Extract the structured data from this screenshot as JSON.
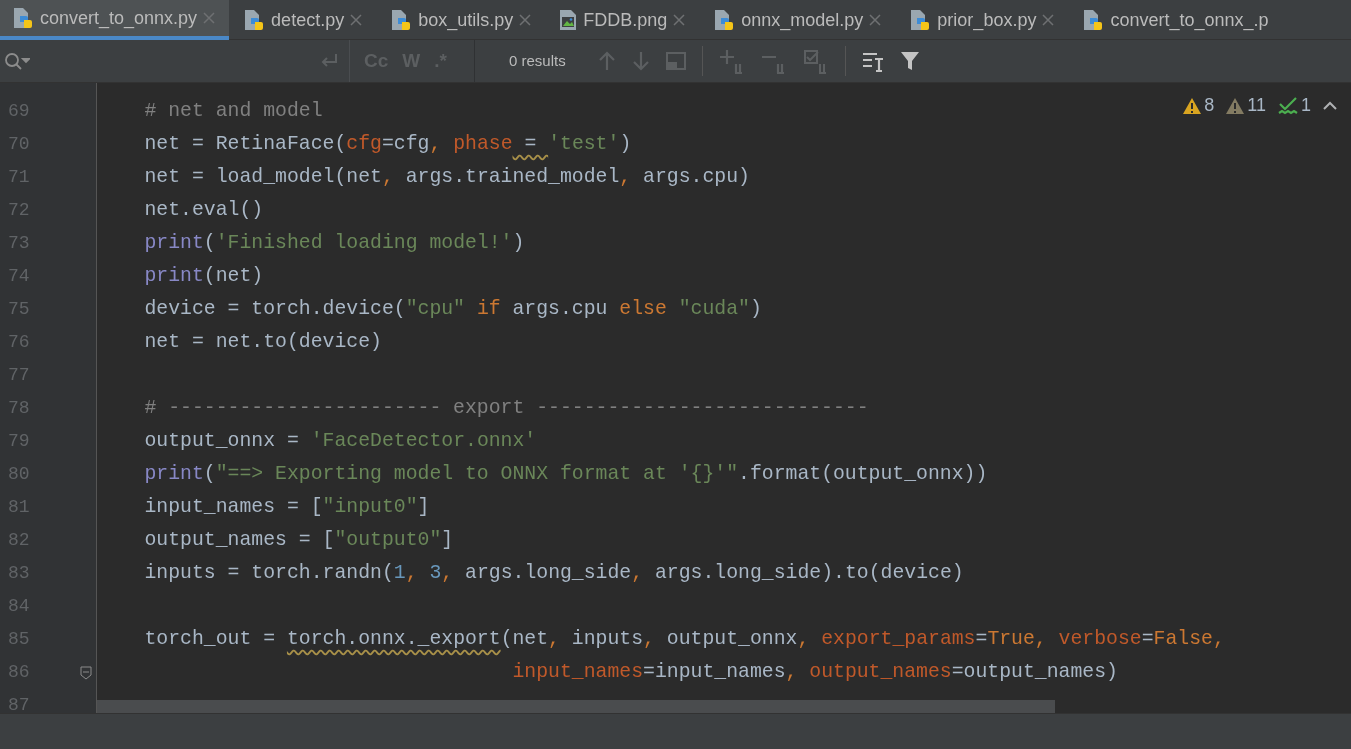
{
  "tabs": [
    {
      "label": "convert_to_onnx.py",
      "kind": "python",
      "selected": true
    },
    {
      "label": "detect.py",
      "kind": "python",
      "selected": false
    },
    {
      "label": "box_utils.py",
      "kind": "python",
      "selected": false
    },
    {
      "label": "FDDB.png",
      "kind": "image",
      "selected": false
    },
    {
      "label": "onnx_model.py",
      "kind": "python",
      "selected": false
    },
    {
      "label": "prior_box.py",
      "kind": "python",
      "selected": false
    },
    {
      "label": "convert_to_onnx_.p",
      "kind": "python",
      "selected": false
    }
  ],
  "find_bar": {
    "results": "0 results",
    "options": [
      "Cc",
      "W",
      ".*"
    ]
  },
  "inspections": [
    {
      "kind": "warning",
      "count": "8"
    },
    {
      "kind": "weak_warning",
      "count": "11"
    },
    {
      "kind": "typo",
      "count": "1"
    }
  ],
  "lines": [
    {
      "number": "69",
      "tokens": [
        {
          "kind": "comment",
          "text": "    # net and model"
        }
      ]
    },
    {
      "number": "70",
      "tokens": [
        {
          "kind": "plain",
          "text": "    net = RetinaFace("
        },
        {
          "kind": "param",
          "text": "cfg"
        },
        {
          "kind": "plain",
          "text": "=cfg"
        },
        {
          "kind": "keyword",
          "text": ", "
        },
        {
          "kind": "param",
          "text": "phase"
        },
        {
          "kind": "plain",
          "text": " = ",
          "squiggle": true
        },
        {
          "kind": "string",
          "text": "'test'"
        },
        {
          "kind": "plain",
          "text": ")"
        }
      ]
    },
    {
      "number": "71",
      "tokens": [
        {
          "kind": "plain",
          "text": "    net = load_model(net"
        },
        {
          "kind": "keyword",
          "text": ", "
        },
        {
          "kind": "plain",
          "text": "args.trained_model"
        },
        {
          "kind": "keyword",
          "text": ", "
        },
        {
          "kind": "plain",
          "text": "args.cpu)"
        }
      ]
    },
    {
      "number": "72",
      "tokens": [
        {
          "kind": "plain",
          "text": "    net.eval()"
        }
      ]
    },
    {
      "number": "73",
      "tokens": [
        {
          "kind": "builtin",
          "text": "    print"
        },
        {
          "kind": "plain",
          "text": "("
        },
        {
          "kind": "string",
          "text": "'Finished loading model!'"
        },
        {
          "kind": "plain",
          "text": ")"
        }
      ]
    },
    {
      "number": "74",
      "tokens": [
        {
          "kind": "builtin",
          "text": "    print"
        },
        {
          "kind": "plain",
          "text": "(net)"
        }
      ]
    },
    {
      "number": "75",
      "tokens": [
        {
          "kind": "plain",
          "text": "    device = torch.device("
        },
        {
          "kind": "string",
          "text": "\"cpu\" "
        },
        {
          "kind": "keyword",
          "text": "if "
        },
        {
          "kind": "plain",
          "text": "args.cpu "
        },
        {
          "kind": "keyword",
          "text": "else "
        },
        {
          "kind": "string",
          "text": "\"cuda\""
        },
        {
          "kind": "plain",
          "text": ")"
        }
      ]
    },
    {
      "number": "76",
      "tokens": [
        {
          "kind": "plain",
          "text": "    net = net.to(device)"
        }
      ]
    },
    {
      "number": "77"
    },
    {
      "number": "78",
      "tokens": [
        {
          "kind": "comment",
          "text": "    # ----------------------- export ----------------------------"
        }
      ]
    },
    {
      "number": "79",
      "tokens": [
        {
          "kind": "plain",
          "text": "    output_onnx = "
        },
        {
          "kind": "string",
          "text": "'FaceDetector.onnx'"
        }
      ]
    },
    {
      "number": "80",
      "tokens": [
        {
          "kind": "builtin",
          "text": "    print"
        },
        {
          "kind": "plain",
          "text": "("
        },
        {
          "kind": "string",
          "text": "\"==> Exporting model to ONNX format at '{}'\""
        },
        {
          "kind": "plain",
          "text": ".format(output_onnx))"
        }
      ]
    },
    {
      "number": "81",
      "tokens": [
        {
          "kind": "plain",
          "text": "    input_names = ["
        },
        {
          "kind": "string",
          "text": "\"input0\""
        },
        {
          "kind": "plain",
          "text": "]"
        }
      ]
    },
    {
      "number": "82",
      "tokens": [
        {
          "kind": "plain",
          "text": "    output_names = ["
        },
        {
          "kind": "string",
          "text": "\"output0\""
        },
        {
          "kind": "plain",
          "text": "]"
        }
      ]
    },
    {
      "number": "83",
      "tokens": [
        {
          "kind": "plain",
          "text": "    inputs = torch.randn("
        },
        {
          "kind": "number",
          "text": "1"
        },
        {
          "kind": "keyword",
          "text": ", "
        },
        {
          "kind": "number",
          "text": "3"
        },
        {
          "kind": "keyword",
          "text": ", "
        },
        {
          "kind": "plain",
          "text": "args.long_side"
        },
        {
          "kind": "keyword",
          "text": ", "
        },
        {
          "kind": "plain",
          "text": "args.long_side).to(device)"
        }
      ]
    },
    {
      "number": "84"
    },
    {
      "number": "85",
      "tokens": [
        {
          "kind": "plain",
          "text": "    torch_out = "
        },
        {
          "kind": "plain",
          "text": "torch.onnx._export",
          "squiggle": true
        },
        {
          "kind": "plain",
          "text": "(net"
        },
        {
          "kind": "keyword",
          "text": ", "
        },
        {
          "kind": "plain",
          "text": "inputs"
        },
        {
          "kind": "keyword",
          "text": ", "
        },
        {
          "kind": "plain",
          "text": "output_onnx"
        },
        {
          "kind": "keyword",
          "text": ", "
        },
        {
          "kind": "param",
          "text": "export_params"
        },
        {
          "kind": "plain",
          "text": "="
        },
        {
          "kind": "keyword",
          "text": "True, "
        },
        {
          "kind": "param",
          "text": "verbose"
        },
        {
          "kind": "plain",
          "text": "="
        },
        {
          "kind": "keyword",
          "text": "False,"
        }
      ]
    },
    {
      "number": "86",
      "fold": true,
      "tokens": [
        {
          "kind": "param",
          "text": "                                   input_names"
        },
        {
          "kind": "plain",
          "text": "=input_names"
        },
        {
          "kind": "keyword",
          "text": ", "
        },
        {
          "kind": "param",
          "text": "output_names"
        },
        {
          "kind": "plain",
          "text": "=output_names)"
        }
      ]
    },
    {
      "number": "87"
    }
  ]
}
